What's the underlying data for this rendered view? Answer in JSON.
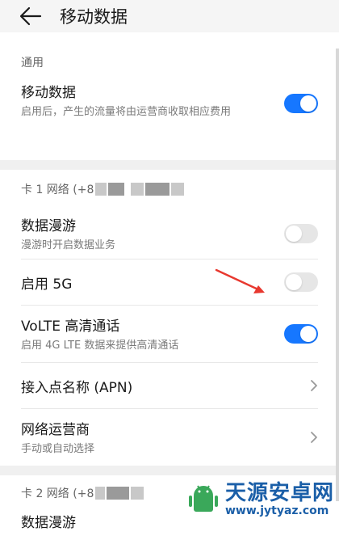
{
  "header": {
    "title": "移动数据",
    "back_icon": "arrow-left-icon"
  },
  "general": {
    "label": "通用",
    "mobile_data": {
      "title": "移动数据",
      "subtitle": "启用后，产生的流量将由运营商收取相应费用",
      "enabled": true
    }
  },
  "sim1": {
    "label": "卡 1 网络 (+8",
    "roaming": {
      "title": "数据漫游",
      "subtitle": "漫游时开启数据业务",
      "enabled": false
    },
    "enable_5g": {
      "title": "启用 5G",
      "enabled": false
    },
    "volte": {
      "title": "VoLTE 高清通话",
      "subtitle": "启用 4G LTE 数据来提供高清通话",
      "enabled": true
    },
    "apn": {
      "title": "接入点名称 (APN)"
    },
    "carrier": {
      "title": "网络运营商",
      "subtitle": "手动或自动选择"
    }
  },
  "sim2": {
    "label": "卡 2 网络 (+8",
    "partial_row": "数据漫游"
  },
  "watermark": {
    "main": "天源安卓网",
    "url": "www.jytyaz.com"
  },
  "colors": {
    "accent": "#1677ff",
    "annotation": "#e8382f"
  }
}
